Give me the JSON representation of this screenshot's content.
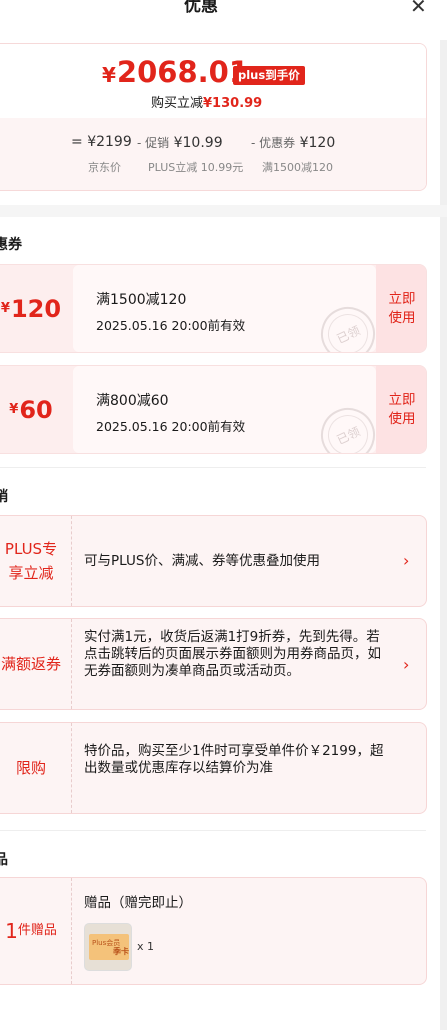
{
  "header": {
    "title": "优惠",
    "close_label": "✕"
  },
  "price": {
    "currency": "¥",
    "final_price": "2068.01",
    "badge": "plus到手价",
    "reduce_label": "购买立减",
    "reduce_amount": "¥130.99",
    "breakdown": [
      {
        "prefix": "=",
        "value": "¥2199",
        "caption": "京东价"
      },
      {
        "prefix": "- 促销",
        "value": "¥10.99",
        "caption": "PLUS立减 10.99元"
      },
      {
        "prefix": "- 优惠券",
        "value": "¥120",
        "caption": "满1500减120"
      }
    ]
  },
  "coupons_section": {
    "title": "惠券"
  },
  "coupons": [
    {
      "currency": "¥",
      "amount": "120",
      "title": "满1500减120",
      "valid": "2025.05.16 20:00前有效",
      "stamp": "已领",
      "action": "立即\n使用"
    },
    {
      "currency": "¥",
      "amount": "60",
      "title": "满800减60",
      "valid": "2025.05.16 20:00前有效",
      "stamp": "已领",
      "action": "立即\n使用"
    }
  ],
  "promo_section": {
    "title": "销"
  },
  "promos": [
    {
      "label": "PLUS专\n享立减",
      "text": "可与PLUS价、满减、券等优惠叠加使用",
      "arrow": "›"
    },
    {
      "label": "满额返券",
      "text": "实付满1元，收货后返满1打9折券，先到先得。若点击跳转后的页面展示券面额则为用券商品页，如无券面额则为凑单商品页或活动页。",
      "arrow": "›"
    },
    {
      "label": "限购",
      "text": "特价品，购买至少1件时可享受单件价￥2199，超出数量或优惠库存以结算价为准"
    }
  ],
  "gift_section": {
    "title": "品"
  },
  "gift": {
    "label_num": "1",
    "label_text": "件赠品",
    "title": "赠品（赠完即止）",
    "qty": "x 1",
    "thumb_text_a": "Plus会员",
    "thumb_text_b": "季卡"
  },
  "colors": {
    "accent": "#e1251b",
    "coupon_bg": "#fdeeee",
    "use_bg": "#fde2e3"
  }
}
